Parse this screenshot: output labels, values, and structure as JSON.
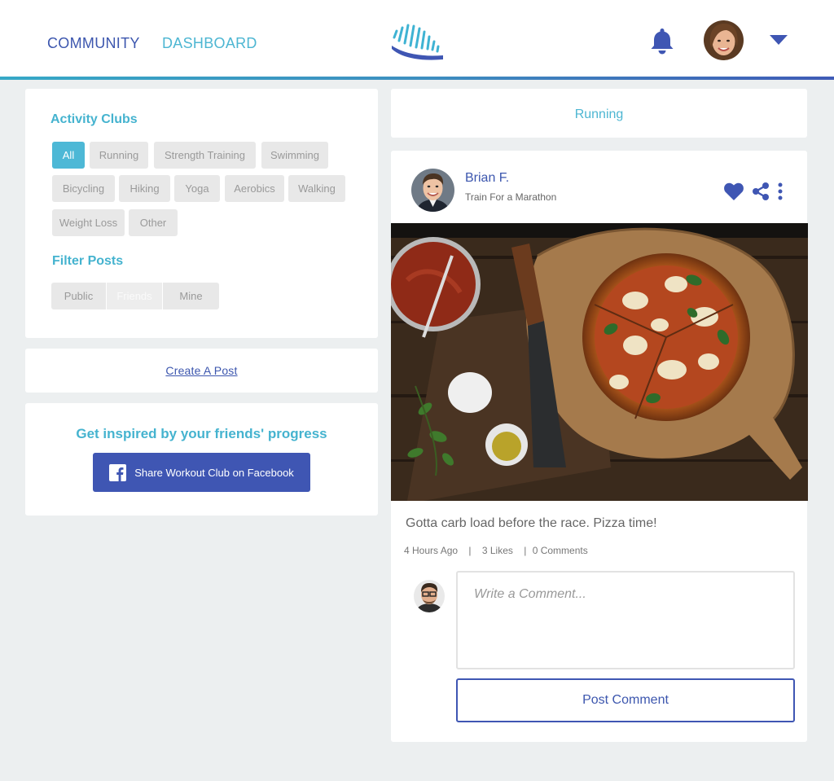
{
  "nav": {
    "community": "COMMUNITY",
    "dashboard": "DASHBOARD",
    "logo": "wave-footprint-logo",
    "icons": {
      "bell": "bell-icon",
      "caret": "caret-down-icon"
    }
  },
  "clubs": {
    "title": "Activity Clubs",
    "tags": [
      {
        "label": "All",
        "active": true
      },
      {
        "label": "Running",
        "active": false
      },
      {
        "label": "Strength Training",
        "active": false
      },
      {
        "label": "Swimming",
        "active": false
      },
      {
        "label": "Bicycling",
        "active": false
      },
      {
        "label": "Hiking",
        "active": false
      },
      {
        "label": "Yoga",
        "active": false
      },
      {
        "label": "Aerobics",
        "active": false
      },
      {
        "label": "Walking",
        "active": false
      },
      {
        "label": "Weight Loss",
        "active": false
      },
      {
        "label": "Other",
        "active": false
      }
    ]
  },
  "filter": {
    "title": "Filter Posts",
    "options": [
      {
        "label": "Public",
        "selected": false
      },
      {
        "label": "Friends",
        "selected": true
      },
      {
        "label": "Mine",
        "selected": false
      }
    ]
  },
  "create": {
    "label": "Create A Post"
  },
  "inspire": {
    "title": "Get inspired by your friends' progress",
    "button_label": "Share Workout Club on Facebook"
  },
  "category": {
    "label": "Running"
  },
  "post": {
    "author": "Brian F.",
    "subtitle": "Train For a Marathon",
    "text": "Gotta carb load before the race. Pizza time!",
    "time": "4 Hours Ago",
    "likes": "3 Likes",
    "comments": "0 Comments",
    "icons": {
      "like": "heart-icon",
      "share": "share-icon",
      "more": "more-vertical-icon"
    }
  },
  "comment": {
    "placeholder": "Write a Comment...",
    "value": "",
    "button_label": "Post Comment"
  },
  "colors": {
    "brand_blue": "#3f56b3",
    "accent_teal": "#4db6d2",
    "background": "#eceff0",
    "tag_bg": "#e8e8e8"
  }
}
